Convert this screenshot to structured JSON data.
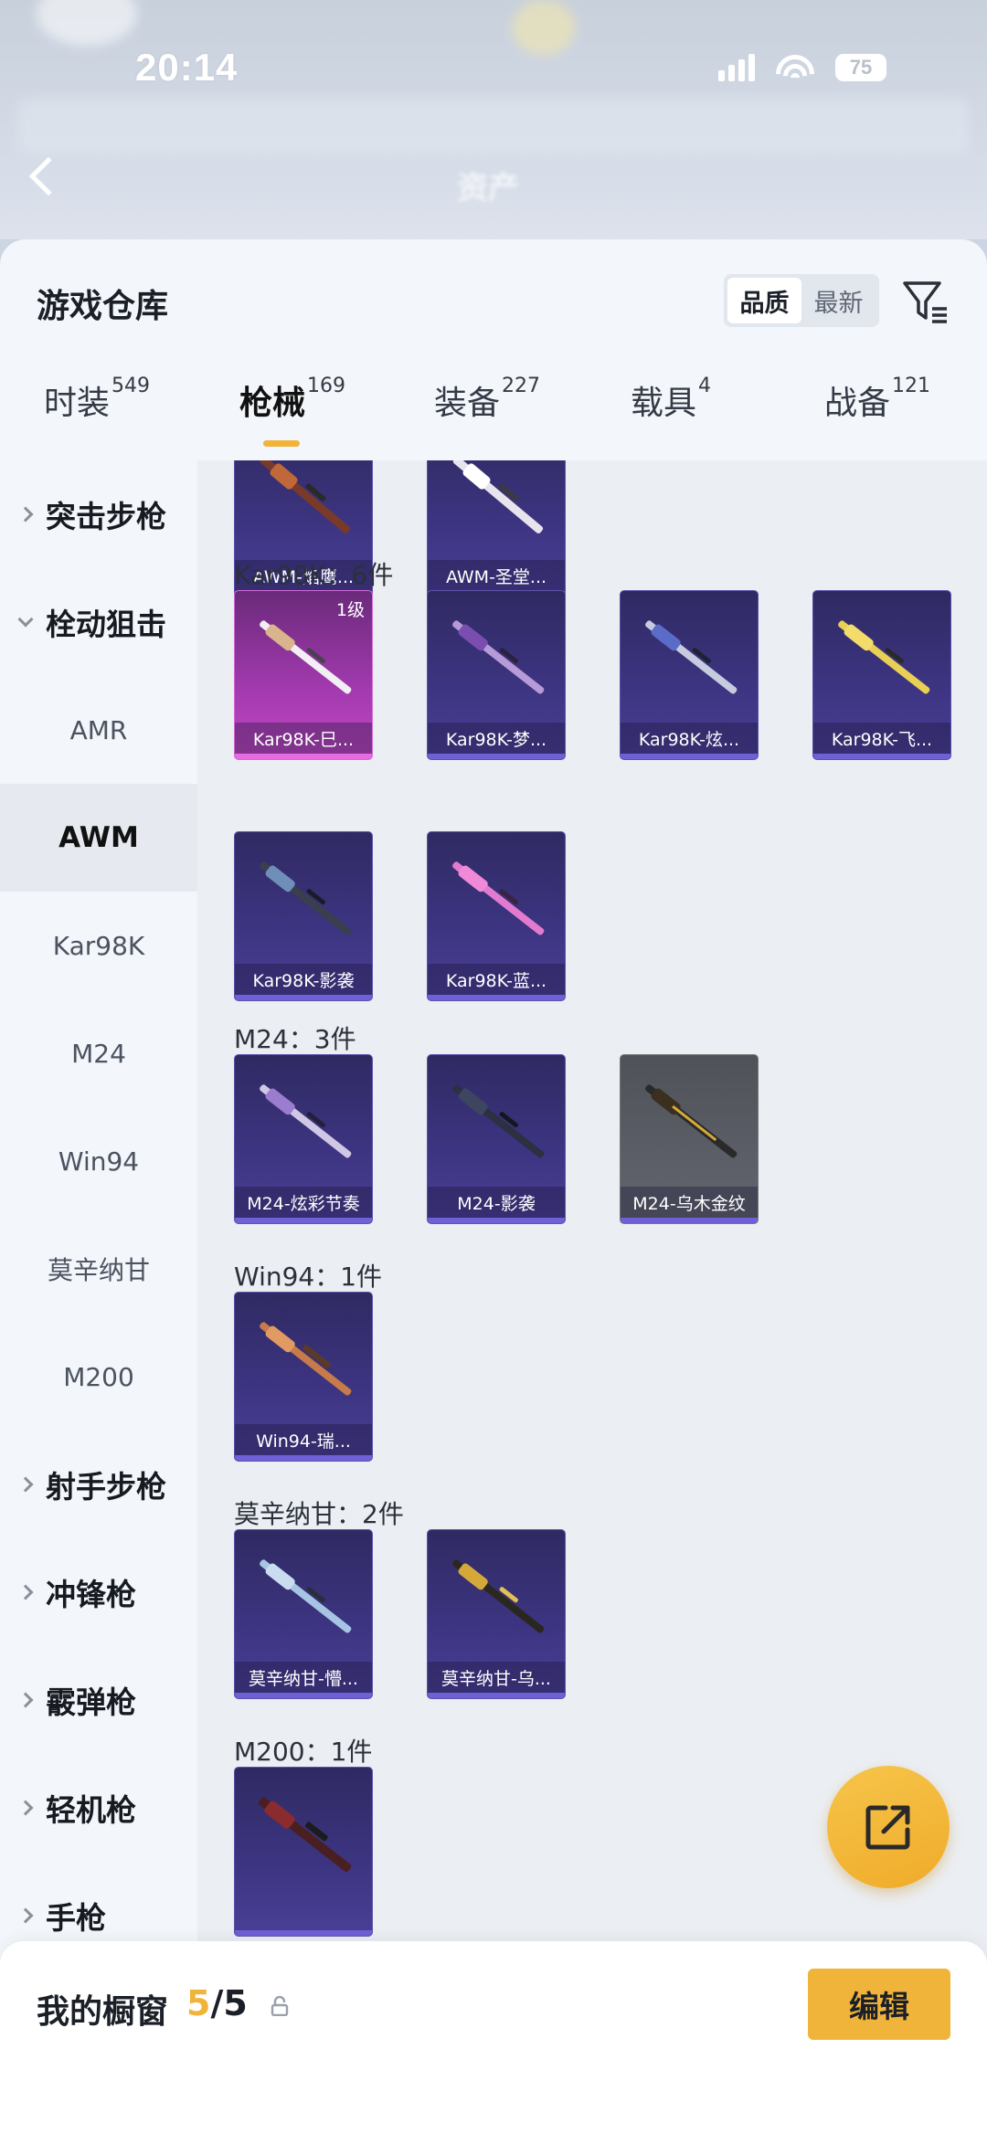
{
  "status_bar": {
    "time": "20:14",
    "battery": "75"
  },
  "background": {
    "page_title": "资产"
  },
  "sheet": {
    "title": "游戏仓库"
  },
  "sort": {
    "options": [
      "品质",
      "最新"
    ],
    "selected": "品质"
  },
  "tabs": [
    {
      "label": "时装",
      "count": "549"
    },
    {
      "label": "枪械",
      "count": "169",
      "active": true
    },
    {
      "label": "装备",
      "count": "227"
    },
    {
      "label": "载具",
      "count": "4"
    },
    {
      "label": "战备",
      "count": "121"
    }
  ],
  "sidebar": {
    "items": [
      {
        "label": "突击步枪",
        "type": "category",
        "expanded": false
      },
      {
        "label": "栓动狙击",
        "type": "category",
        "expanded": true
      },
      {
        "label": "AMR",
        "type": "sub"
      },
      {
        "label": "AWM",
        "type": "sub",
        "active": true
      },
      {
        "label": "Kar98K",
        "type": "sub"
      },
      {
        "label": "M24",
        "type": "sub"
      },
      {
        "label": "Win94",
        "type": "sub"
      },
      {
        "label": "莫辛纳甘",
        "type": "sub"
      },
      {
        "label": "M200",
        "type": "sub"
      },
      {
        "label": "射手步枪",
        "type": "category",
        "expanded": false
      },
      {
        "label": "冲锋枪",
        "type": "category",
        "expanded": false
      },
      {
        "label": "霰弹枪",
        "type": "category",
        "expanded": false
      },
      {
        "label": "轻机枪",
        "type": "category",
        "expanded": false
      },
      {
        "label": "手枪",
        "type": "category",
        "expanded": false
      }
    ]
  },
  "groups": {
    "awm": {
      "items": [
        "AWM-焰鹰...",
        "AWM-圣堂..."
      ]
    },
    "kar98k": {
      "label": "Kar98K：6件",
      "items": [
        "Kar98K-巳...",
        "Kar98K-梦...",
        "Kar98K-炫...",
        "Kar98K-飞...",
        "Kar98K-影袭",
        "Kar98K-蓝..."
      ],
      "first_level": "1级"
    },
    "m24": {
      "label": "M24：3件",
      "items": [
        "M24-炫彩节奏",
        "M24-影袭",
        "M24-乌木金纹"
      ]
    },
    "win94": {
      "label": "Win94：1件",
      "items": [
        "Win94-瑞..."
      ]
    },
    "mosin": {
      "label": "莫辛纳甘：2件",
      "items": [
        "莫辛纳甘-懵...",
        "莫辛纳甘-乌..."
      ]
    },
    "m200": {
      "label": "M200：1件"
    }
  },
  "bottom": {
    "title": "我的橱窗",
    "count_current": "5",
    "count_sep": "/",
    "count_total": "5",
    "edit_label": "编辑"
  },
  "colors": {
    "accent": "#f0b43a",
    "card_purple": "#3c3480",
    "card_pink": "#c348c2"
  },
  "icons": [
    "back-arrow-icon",
    "filter-icon",
    "share-icon",
    "lock-icon",
    "chevron-right-icon",
    "chevron-down-icon",
    "rifle-icon"
  ]
}
